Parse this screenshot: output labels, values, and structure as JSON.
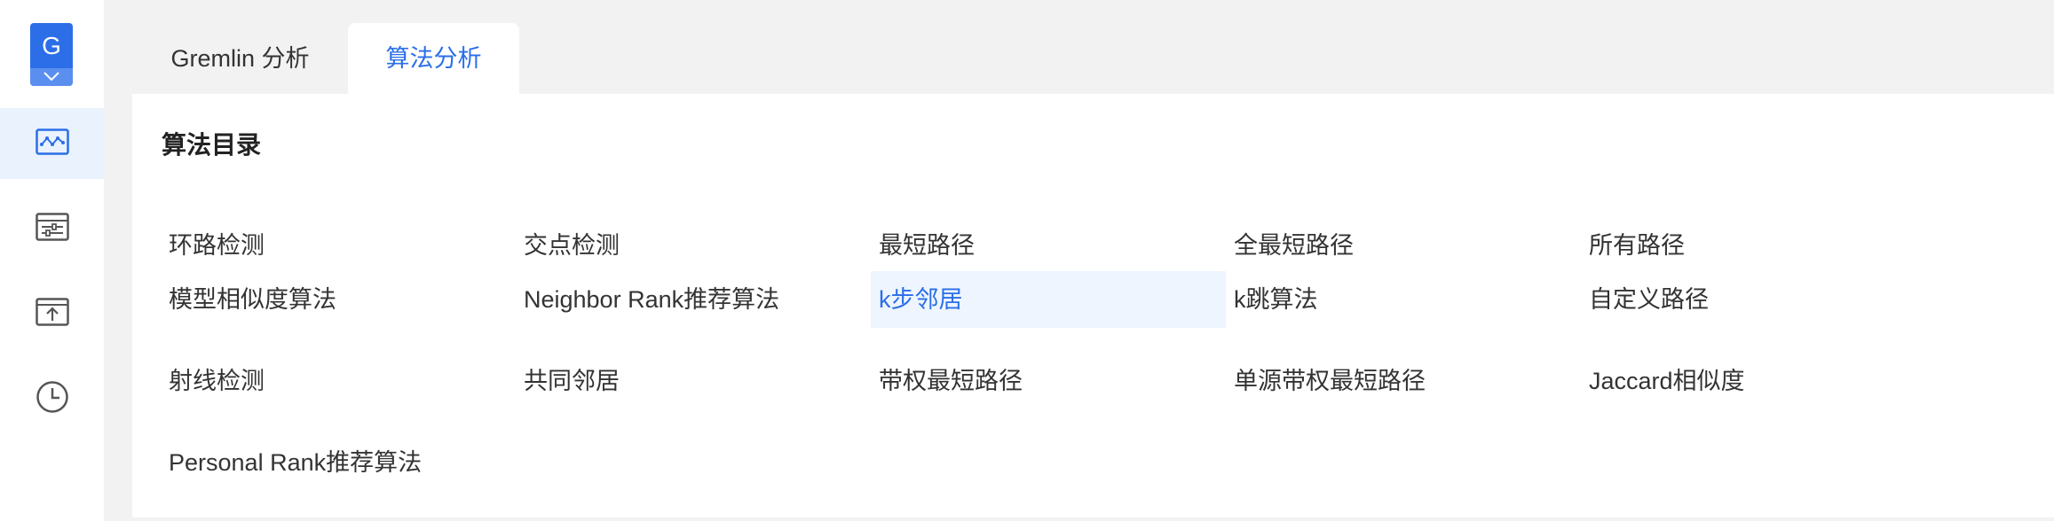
{
  "app": {
    "logo_letter": "G",
    "accent": "#2b6ee8"
  },
  "sidebar": {
    "items": [
      {
        "icon": "graph-analysis-icon",
        "active": true
      },
      {
        "icon": "data-import-icon",
        "active": false
      },
      {
        "icon": "upload-icon",
        "active": false
      },
      {
        "icon": "history-clock-icon",
        "active": false
      }
    ]
  },
  "tabs": [
    {
      "label": "Gremlin 分析",
      "active": false
    },
    {
      "label": "算法分析",
      "active": true
    }
  ],
  "panel": {
    "title": "算法目录",
    "algorithms": [
      [
        "环路检测",
        "交点检测",
        "最短路径",
        "全最短路径",
        "所有路径"
      ],
      [
        "模型相似度算法",
        "Neighbor Rank推荐算法",
        "k步邻居",
        "k跳算法",
        "自定义路径"
      ],
      [
        "射线检测",
        "共同邻居",
        "带权最短路径",
        "单源带权最短路径",
        "Jaccard相似度"
      ],
      [
        "Personal Rank推荐算法"
      ]
    ],
    "selected": "k步邻居"
  }
}
